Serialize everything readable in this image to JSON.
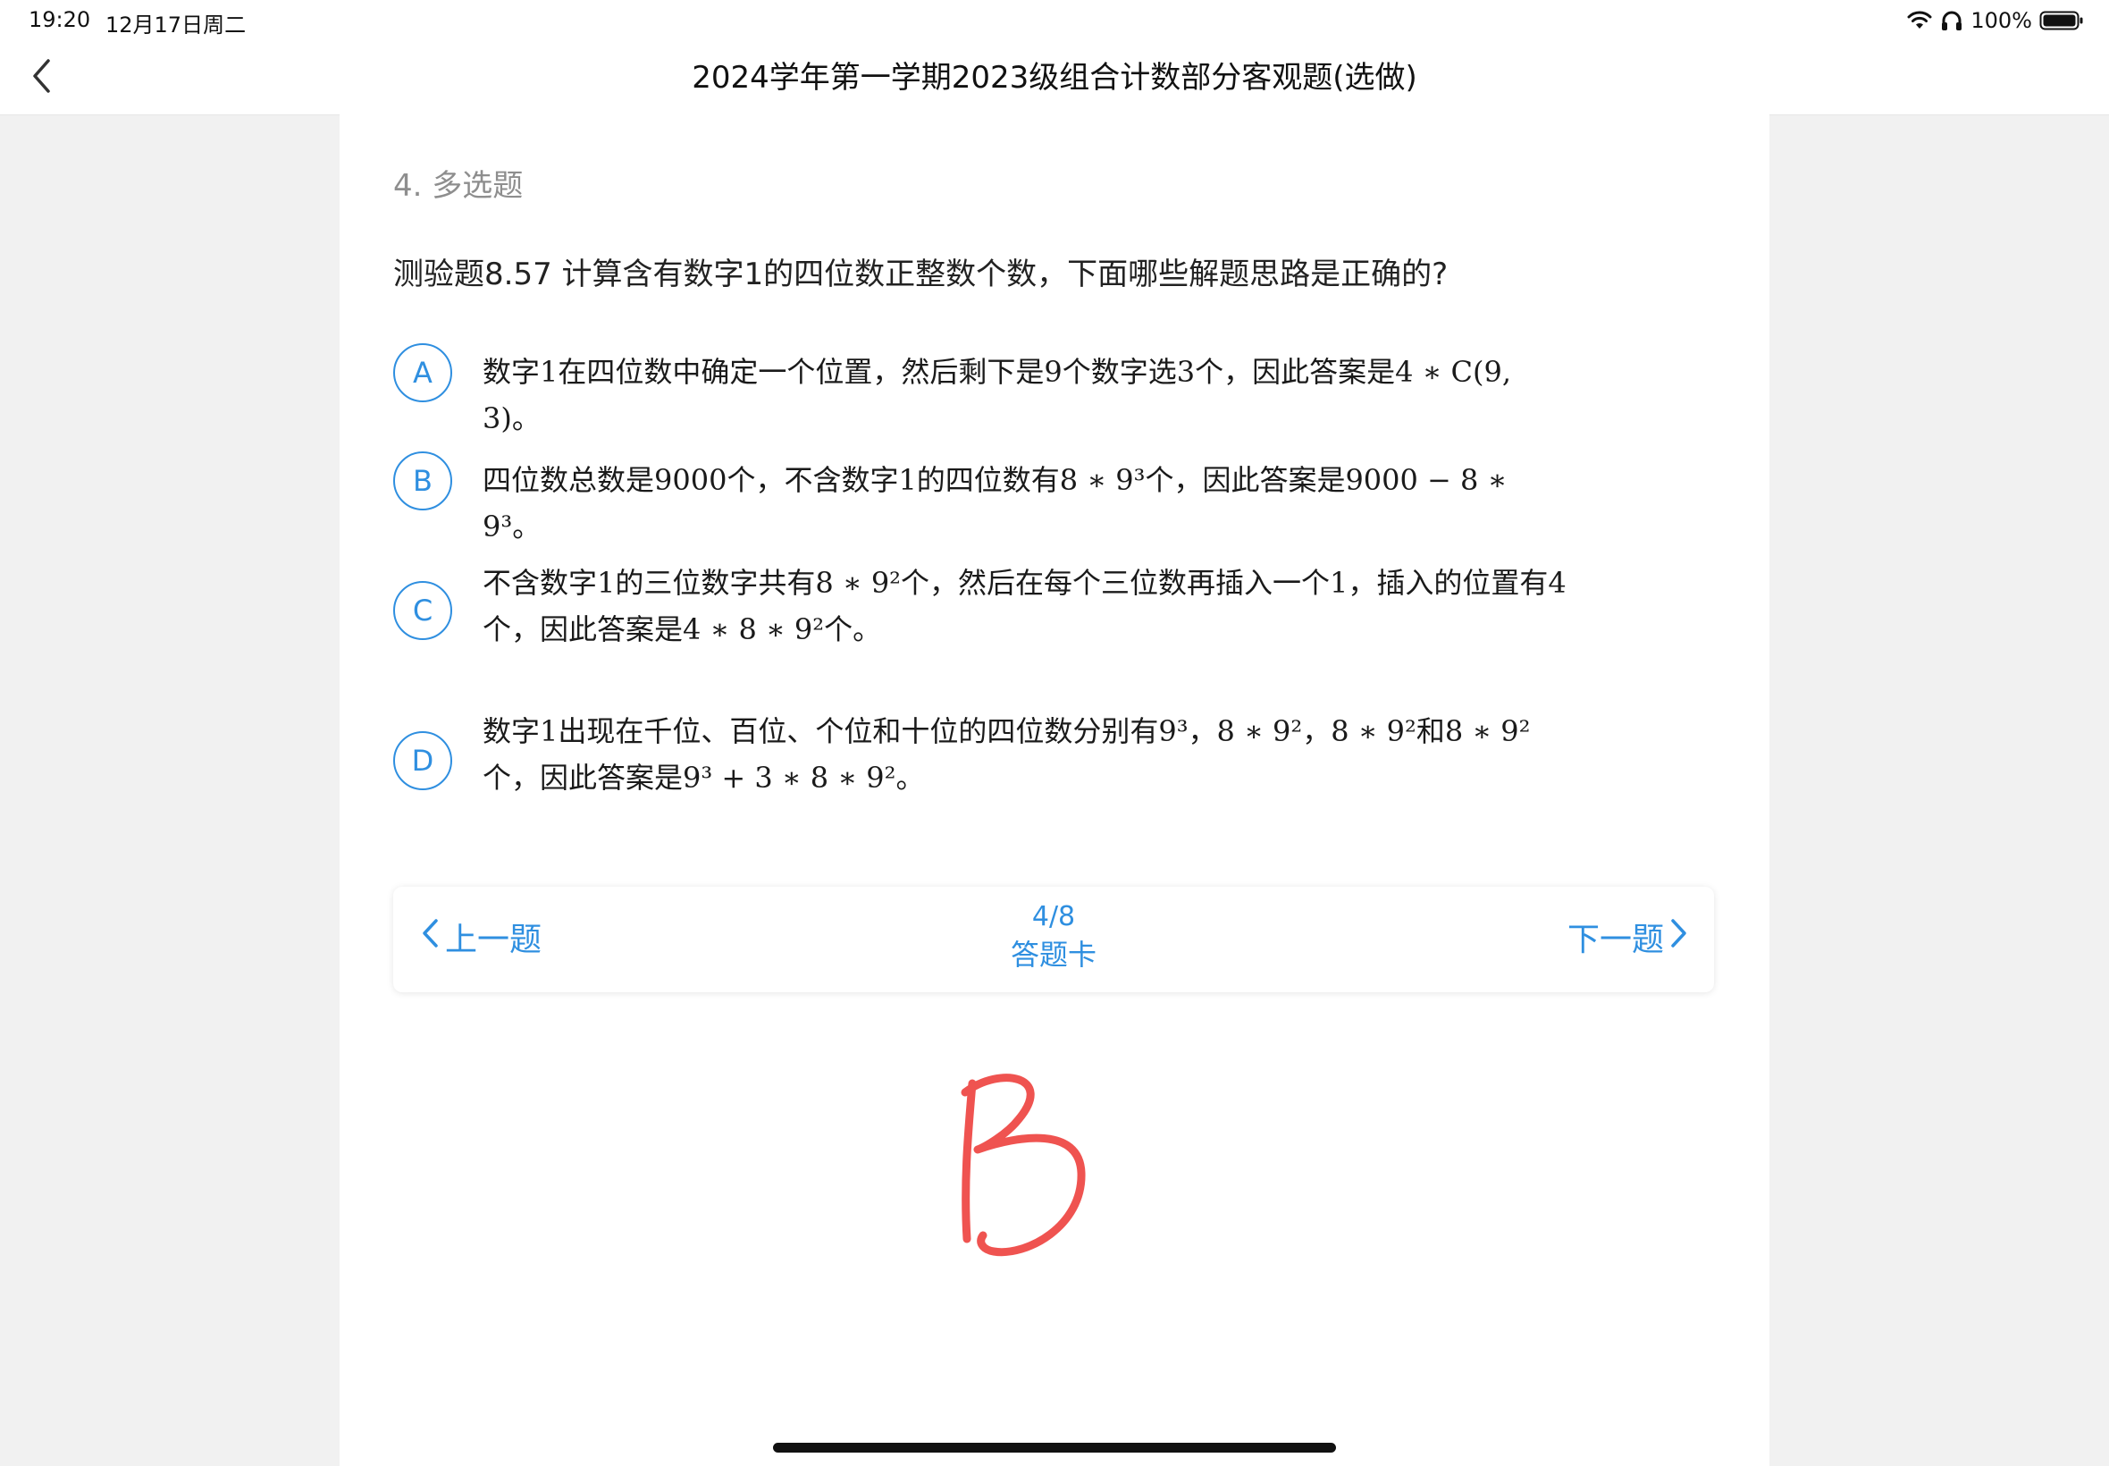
{
  "status_bar": {
    "time": "19:20",
    "date": "12月17日周二",
    "battery": "100%",
    "icons": [
      "wifi-icon",
      "headphones-icon",
      "battery-icon"
    ]
  },
  "nav": {
    "back_icon": "chevron-left-icon",
    "title": "2024学年第一学期2023级组合计数部分客观题(选做)"
  },
  "question": {
    "type_label": "4. 多选题",
    "text": "测验题8.57 计算含有数字1的四位数正整数个数，下面哪些解题思路是正确的?",
    "options": [
      {
        "letter": "A",
        "text": "数字1在四位数中确定一个位置，然后剩下是9个数字选3个，因此答案是4 ∗ C(9, 3)。"
      },
      {
        "letter": "B",
        "text": "四位数总数是9000个，不含数字1的四位数有8 ∗ 9³个，因此答案是9000 − 8 ∗ 9³。"
      },
      {
        "letter": "C",
        "text": "不含数字1的三位数字共有8 ∗ 9²个，然后在每个三位数再插入一个1，插入的位置有4个，因此答案是4 ∗ 8 ∗ 9²个。"
      },
      {
        "letter": "D",
        "text": "数字1出现在千位、百位、个位和十位的四位数分别有9³，8 ∗ 9²，8 ∗ 9²和8 ∗ 9²个，因此答案是9³ + 3 ∗ 8 ∗ 9²。"
      }
    ]
  },
  "navigation": {
    "prev_label": "上一题",
    "next_label": "下一题",
    "progress": "4/8",
    "card_label": "答题卡"
  },
  "handwritten_answer": "B",
  "colors": {
    "accent": "#2f8fe0",
    "handwriting": "#ef5350",
    "background": "#f1f1f1"
  }
}
